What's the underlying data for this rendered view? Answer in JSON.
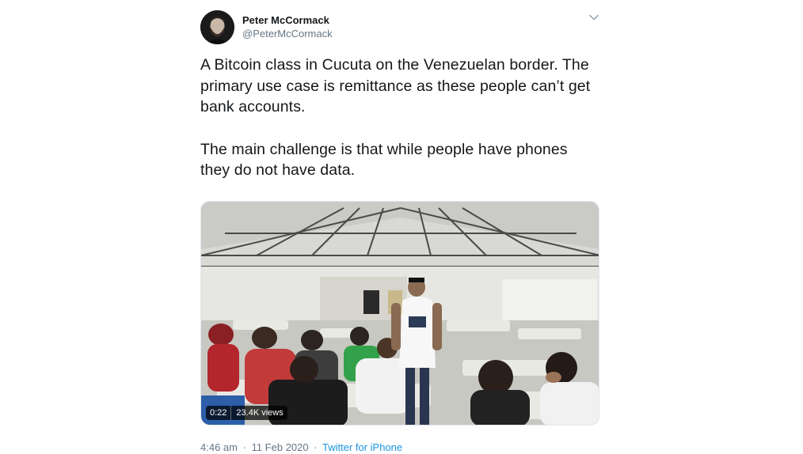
{
  "author": {
    "display_name": "Peter McCormack",
    "handle": "@PeterMcCormack",
    "avatar_icon": "avatar-photo"
  },
  "tweet": {
    "paragraphs": [
      "A Bitcoin class in Cucuta on the Venezuelan border. The primary use case is remittance as these people can’t get bank accounts.",
      "The main challenge is that while people have phones they do not have data."
    ]
  },
  "video": {
    "duration": "0:22",
    "views": "23.4K views"
  },
  "meta": {
    "time": "4:46 am",
    "separator": "·",
    "date": "11 Feb 2020",
    "source": "Twitter for iPhone"
  },
  "colors": {
    "text": "#14171a",
    "secondary": "#657786",
    "link": "#1b95e0"
  },
  "icons": {
    "menu": "chevron-down-icon"
  }
}
